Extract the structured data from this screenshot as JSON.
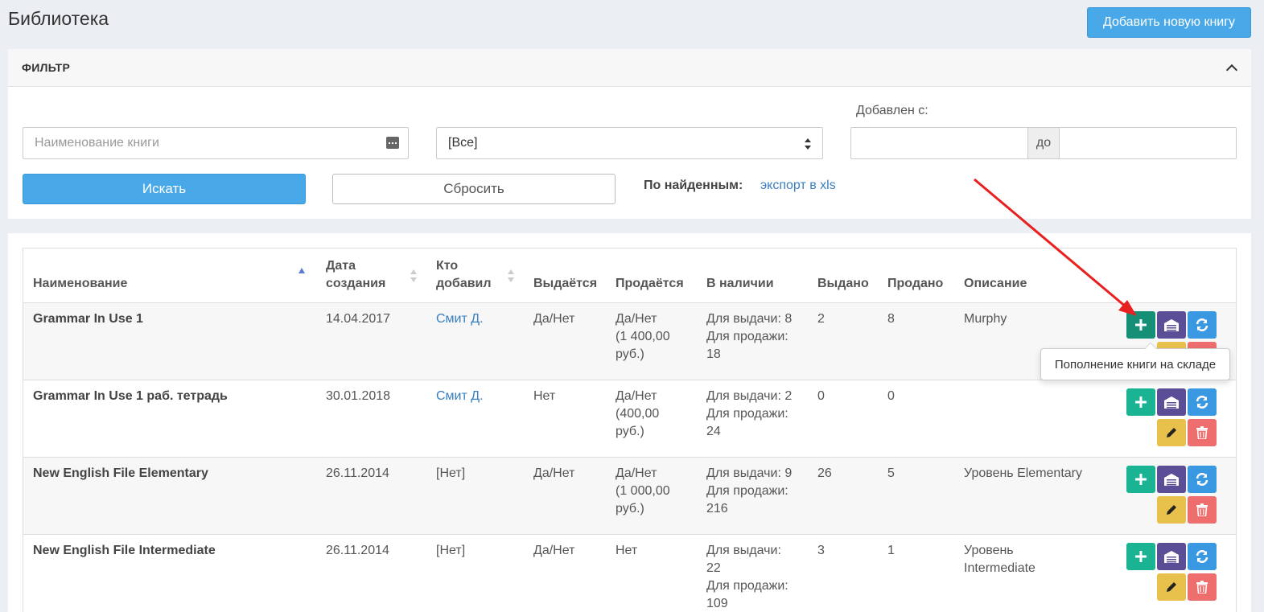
{
  "header": {
    "title": "Библиотека",
    "add_button": "Добавить новую книгу"
  },
  "filter": {
    "title": "ФИЛЬТР",
    "name_placeholder": "Наименование книги",
    "select_value": "[Все]",
    "date_label": "Добавлен с:",
    "date_separator": "до",
    "search_button": "Искать",
    "reset_button": "Сбросить",
    "found_label": "По найденным:",
    "export_link": "экспорт в xls"
  },
  "table": {
    "columns": {
      "name": "Наименование",
      "created_1": "Дата",
      "created_2": "создания",
      "added_by_1": "Кто",
      "added_by_2": "добавил",
      "lend": "Выдаётся",
      "sell": "Продаётся",
      "in_stock": "В наличии",
      "lent": "Выдано",
      "sold": "Продано",
      "description": "Описание"
    },
    "rows": [
      {
        "name": "Grammar In Use 1",
        "date": "14.04.2017",
        "added_by": "Смит Д.",
        "added_by_is_link": true,
        "lend": "Да/Нет",
        "sell_1": "Да/Нет",
        "sell_2": "(1 400,00",
        "sell_3": "руб.)",
        "stock_1": "Для выдачи: 8",
        "stock_2": "Для продажи:",
        "stock_3": "18",
        "lent": "2",
        "sold": "8",
        "description": "Murphy"
      },
      {
        "name": "Grammar In Use 1 раб. тетрадь",
        "date": "30.01.2018",
        "added_by": "Смит Д.",
        "added_by_is_link": true,
        "lend": "Нет",
        "sell_1": "Да/Нет",
        "sell_2": "(400,00",
        "sell_3": "руб.)",
        "stock_1": "Для выдачи: 2",
        "stock_2": "Для продажи:",
        "stock_3": "24",
        "lent": "0",
        "sold": "0",
        "description": ""
      },
      {
        "name": "New English File Elementary",
        "date": "26.11.2014",
        "added_by": "[Нет]",
        "added_by_is_link": false,
        "lend": "Да/Нет",
        "sell_1": "Да/Нет",
        "sell_2": "(1 000,00",
        "sell_3": "руб.)",
        "stock_1": "Для выдачи: 9",
        "stock_2": "Для продажи:",
        "stock_3": "216",
        "lent": "26",
        "sold": "5",
        "description": "Уровень Elementary"
      },
      {
        "name": "New English File Intermediate",
        "date": "26.11.2014",
        "added_by": "[Нет]",
        "added_by_is_link": false,
        "lend": "Да/Нет",
        "sell_1": "Нет",
        "sell_2": "",
        "sell_3": "",
        "stock_1": "Для выдачи:",
        "stock_2": "22",
        "stock_3": "Для продажи:",
        "stock_4": "109",
        "lent": "3",
        "sold": "1",
        "description": "Уровень",
        "description_2": "Intermediate"
      }
    ]
  },
  "tooltip": {
    "text": "Пополнение книги на складе"
  },
  "icons": {
    "plus": "plus-icon",
    "warehouse": "warehouse-icon",
    "refresh": "refresh-icon",
    "edit": "pencil-icon",
    "delete": "trash-icon"
  },
  "colors": {
    "primary": "#49a9e8",
    "plus": "#1ab394",
    "warehouse": "#5c4d97",
    "refresh": "#3a98e0",
    "edit": "#e8c14d",
    "delete": "#ee6d6d",
    "link": "#3a7fc1",
    "annotation": "#e8201f"
  }
}
